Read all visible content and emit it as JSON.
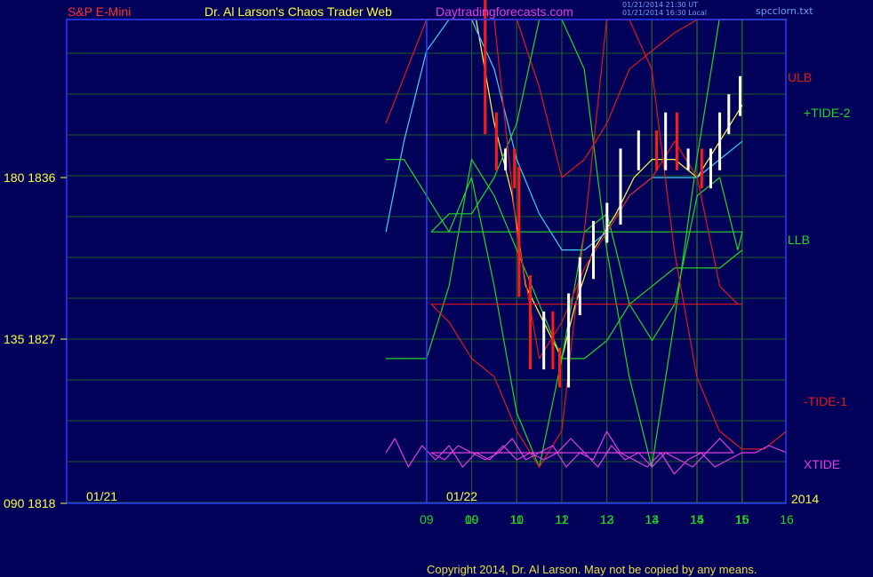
{
  "header": {
    "symbol": "S&P E-Mini",
    "site_title": "Dr. Al Larson's Chaos Trader Web",
    "site_url": "Daytradingforecasts.com",
    "stamp_line1": "01/21/2014 21:30 UT",
    "stamp_line2": "01/21/2014 16:30 Local",
    "file_name": "spcclorn.txt"
  },
  "footer": {
    "copyright": "Copyright 2014, Dr. Al Larson. May not be copied by any means."
  },
  "colors": {
    "background": "#010159",
    "frame": "#2a3cff",
    "grid": "#1f5a2c",
    "price_up": "#ffffff",
    "price_down": "#ff1a1a",
    "ma_fast": "#ffff40",
    "ma_slow": "#3fd0ff",
    "green_line": "#22d822",
    "red_line": "#e01a1a",
    "xtide": "#e040e0"
  },
  "chart_data": {
    "type": "line",
    "title": "",
    "ylabel": "",
    "xlabel": "",
    "grid": true,
    "left_axis": [
      {
        "degree": "180",
        "price": "1836"
      },
      {
        "degree": "135",
        "price": "1827"
      },
      {
        "degree": "090",
        "price": "1818"
      }
    ],
    "ylim_price": [
      1818,
      1854
    ],
    "sessions": [
      {
        "date": "01/21",
        "hours": [
          "09",
          "10",
          "11",
          "12",
          "13",
          "14",
          "15",
          "16"
        ]
      },
      {
        "date": "01/22",
        "hours": [
          "09",
          "10",
          "11",
          "12",
          "13",
          "14",
          "15",
          "16"
        ]
      }
    ],
    "year_label": "2014",
    "right_labels": [
      {
        "text": "ULB",
        "color": "#e01a1a"
      },
      {
        "text": "+TIDE-2",
        "color": "#22d822"
      },
      {
        "text": "LLB",
        "color": "#22d822"
      },
      {
        "text": "-TIDE-1",
        "color": "#e01a1a"
      },
      {
        "text": "XTIDE",
        "color": "#e040e0"
      }
    ],
    "price_bars": {
      "x": [
        8.1,
        8.5,
        8.9,
        9.3,
        9.6,
        9.8,
        9.95,
        10.05,
        10.3,
        10.55,
        10.75,
        10.95,
        11.05,
        11.3,
        11.6,
        11.8,
        11.95,
        12.15,
        12.4,
        12.7,
        13.0,
        13.3,
        13.7,
        14.1,
        14.3,
        14.55,
        14.8,
        15.1,
        15.3,
        15.5,
        15.7,
        15.95
      ],
      "close": [
        1847,
        1848,
        1850,
        1851,
        1852,
        1851,
        1849,
        1847,
        1839,
        1837,
        1837,
        1836,
        1830,
        1826,
        1828,
        1826,
        1825,
        1829,
        1831,
        1833,
        1834,
        1837,
        1838,
        1837,
        1839,
        1837,
        1837,
        1836,
        1837,
        1839,
        1840,
        1841
      ]
    },
    "series": [
      {
        "name": "",
        "role": "fast_average",
        "x": [
          8.1,
          8.6,
          9.0,
          9.5,
          9.9,
          10.1,
          10.5,
          10.9,
          11.2,
          11.6,
          12.0,
          12.3,
          12.7,
          13.2,
          13.6,
          14.0,
          14.5,
          15.0,
          15.5,
          16.0
        ],
        "y": [
          1846,
          1848,
          1849,
          1850,
          1850,
          1846,
          1839,
          1835,
          1830,
          1828,
          1826,
          1829,
          1832,
          1834,
          1836,
          1837,
          1837,
          1836,
          1838,
          1840
        ]
      },
      {
        "name": "",
        "role": "slow_average",
        "x": [
          8.1,
          8.5,
          9.0,
          9.5,
          10.0,
          10.5,
          11.0,
          11.5,
          12.0,
          12.5,
          13.0,
          13.5,
          14.0,
          14.5,
          15.0,
          15.5,
          16.0
        ],
        "y": [
          1833,
          1838,
          1843,
          1846,
          1846,
          1842,
          1837,
          1834,
          1832,
          1832,
          1833,
          1835,
          1836,
          1836,
          1836,
          1837,
          1838
        ]
      },
      {
        "name": "ULB",
        "x": [
          8.1,
          9.0,
          9.5,
          10.0,
          10.5,
          11.0,
          11.5,
          12.0,
          12.5,
          13.0,
          13.5,
          14.0,
          14.5,
          15.0,
          15.5,
          16.0
        ],
        "y": [
          1839,
          1849,
          1853,
          1855,
          1853,
          1847,
          1841,
          1836,
          1837,
          1839,
          1842,
          1843,
          1844,
          1845,
          1846,
          1847
        ]
      },
      {
        "name": "LLB",
        "x": [
          8.1,
          9.0,
          9.5,
          10.0,
          10.5,
          11.0,
          11.5,
          12.0,
          12.5,
          13.0,
          13.5,
          14.0,
          14.5,
          15.0,
          15.5,
          16.0
        ],
        "y": [
          1826,
          1826,
          1830,
          1837,
          1835,
          1832,
          1829,
          1826,
          1826,
          1827,
          1829,
          1830,
          1831,
          1831,
          1831,
          1832
        ]
      },
      {
        "name": "+TIDE-2",
        "x": [
          8.1,
          8.5,
          9.0,
          9.5,
          10.0,
          10.5,
          11.0,
          11.5,
          12.0,
          12.5,
          13.0,
          13.5,
          14.0,
          14.5,
          15.0,
          15.5,
          15.9,
          16.0,
          16.1,
          16.5,
          17.0,
          17.5,
          18.0,
          18.5,
          19.0,
          19.5,
          20.0,
          20.5,
          21.0,
          21.5,
          22.0,
          22.5,
          23.0,
          23.5,
          24.0
        ],
        "y": [
          1837,
          1837,
          1835,
          1833,
          1836,
          1830,
          1823,
          1820,
          1826,
          1833,
          1834,
          1829,
          1827,
          1829,
          1835,
          1836,
          1832,
          1833,
          1833,
          1834,
          1834,
          1836,
          1839,
          1845,
          1848,
          1842,
          1832,
          1825,
          1820,
          1828,
          1837,
          1846,
          1850,
          1851,
          1848
        ]
      },
      {
        "name": "-TIDE-1",
        "x": [
          8.1,
          8.5,
          9.0,
          9.5,
          10.0,
          10.5,
          11.0,
          11.5,
          12.0,
          12.5,
          13.0,
          13.5,
          14.0,
          14.5,
          15.0,
          15.5,
          15.9,
          16.0,
          16.1,
          16.5,
          17.0,
          17.5,
          18.0,
          18.5,
          19.0,
          19.5,
          20.0,
          20.5,
          21.0,
          21.5,
          22.0,
          22.5,
          23.0,
          23.5,
          24.0
        ],
        "y": [
          1848,
          1850,
          1853,
          1858,
          1856,
          1845,
          1833,
          1826,
          1828,
          1831,
          1833,
          1835,
          1836,
          1838,
          1836,
          1830,
          1829,
          1829,
          1829,
          1828,
          1826,
          1825,
          1822,
          1820,
          1822,
          1833,
          1845,
          1848,
          1842,
          1832,
          1825,
          1822,
          1821,
          1821,
          1822
        ]
      },
      {
        "name": "XTIDE",
        "x": [
          8.1,
          8.3,
          8.6,
          8.9,
          9.2,
          9.5,
          9.8,
          10.1,
          10.4,
          10.7,
          11.0,
          11.3,
          11.6,
          11.9,
          12.2,
          12.5,
          12.8,
          13.1,
          13.4,
          13.7,
          14.0,
          14.3,
          14.6,
          14.9,
          15.2,
          15.5,
          15.8,
          16.1,
          16.4,
          16.7,
          17.0,
          17.3,
          17.6,
          17.9,
          18.2,
          18.5,
          18.8,
          19.1,
          19.4,
          19.7,
          20.0,
          20.3,
          20.6,
          20.9,
          21.2,
          21.5,
          21.8,
          22.1,
          22.4,
          22.7,
          23.0,
          23.3,
          23.6,
          24.0
        ],
        "y": [
          1822,
          1824,
          1820,
          1823,
          1821,
          1823,
          1820,
          1822,
          1821,
          1823,
          1821,
          1822,
          1821,
          1822,
          1824,
          1822,
          1820,
          1823,
          1821,
          1822,
          1820,
          1822,
          1821,
          1820,
          1822,
          1824,
          1822,
          1822,
          1821,
          1823,
          1822,
          1821,
          1822,
          1824,
          1821,
          1822,
          1823,
          1820,
          1822,
          1821,
          1825,
          1822,
          1821,
          1820,
          1822,
          1819,
          1821,
          1822,
          1820,
          1821,
          1822,
          1822,
          1823,
          1822
        ]
      }
    ]
  }
}
